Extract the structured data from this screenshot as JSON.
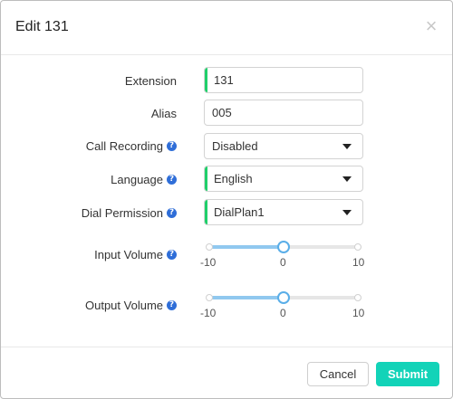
{
  "dialog": {
    "title": "Edit 131",
    "close_glyph": "×"
  },
  "fields": {
    "extension": {
      "label": "Extension",
      "value": "131"
    },
    "alias": {
      "label": "Alias",
      "value": "005"
    },
    "call_recording": {
      "label": "Call Recording",
      "value": "Disabled"
    },
    "language": {
      "label": "Language",
      "value": "English"
    },
    "dial_permission": {
      "label": "Dial Permission",
      "value": "DialPlan1"
    }
  },
  "sliders": {
    "input_volume": {
      "label": "Input Volume",
      "min": "-10",
      "mid": "0",
      "max": "10",
      "value": 0
    },
    "output_volume": {
      "label": "Output Volume",
      "min": "-10",
      "mid": "0",
      "max": "10",
      "value": 0
    }
  },
  "help_glyph": "?",
  "footer": {
    "cancel_label": "Cancel",
    "submit_label": "Submit"
  },
  "colors": {
    "required_marker": "#1fcf6a",
    "help_icon": "#2f6ed8",
    "submit_button": "#12d3b8",
    "slider_fill": "#90c8ef"
  },
  "icons": {
    "close": "close-icon",
    "help": "question-circle-icon",
    "dropdown": "caret-down-icon"
  }
}
